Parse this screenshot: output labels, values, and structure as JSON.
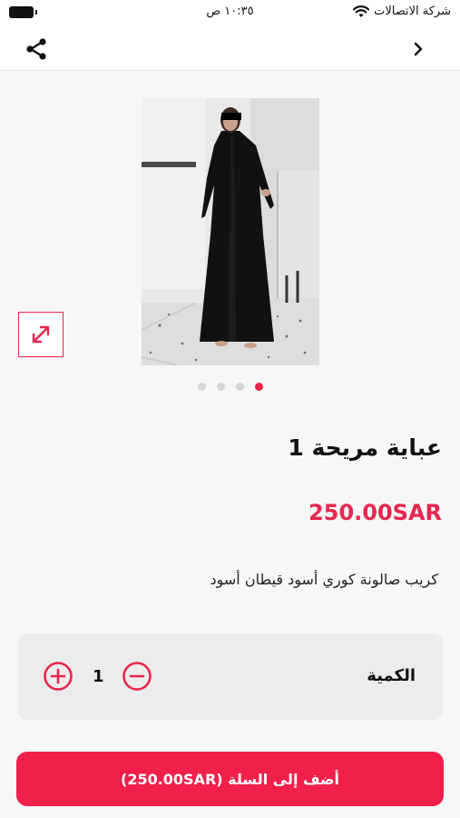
{
  "status_bar": {
    "carrier": "شركة الاتصالات",
    "time": "١٠:٣٥ ص"
  },
  "product": {
    "title": "عباية مريحة 1",
    "price": "250.00SAR",
    "description": "كريب صالونة كوري أسود قيطان أسود",
    "image_count": 4,
    "active_image_index": 0
  },
  "quantity": {
    "label": "الكمية",
    "value": "1"
  },
  "cart": {
    "button_label": "أضف إلى السلة (250.00SAR)"
  },
  "colors": {
    "accent": "#e8264c",
    "button": "#f0204b",
    "background": "#f7f7f7"
  },
  "icons": {
    "share": "share-icon",
    "back": "chevron-right-icon",
    "expand": "expand-icon",
    "plus": "plus-circle-icon",
    "minus": "minus-circle-icon"
  }
}
